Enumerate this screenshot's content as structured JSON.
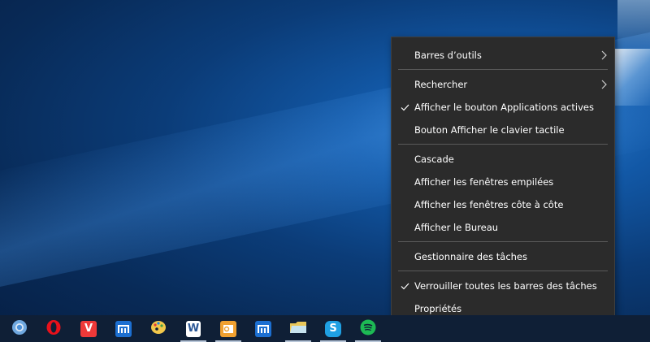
{
  "context_menu": {
    "items": [
      {
        "label": "Barres d’outils",
        "checked": false,
        "submenu": true
      },
      {
        "label": "Rechercher",
        "checked": false,
        "submenu": true
      },
      {
        "label": "Afficher le bouton Applications actives",
        "checked": true,
        "submenu": false
      },
      {
        "label": "Bouton Afficher le clavier tactile",
        "checked": false,
        "submenu": false
      },
      {
        "label": "Cascade",
        "checked": false,
        "submenu": false
      },
      {
        "label": "Afficher les fenêtres empilées",
        "checked": false,
        "submenu": false
      },
      {
        "label": "Afficher les fenêtres côte à côte",
        "checked": false,
        "submenu": false
      },
      {
        "label": "Afficher le Bureau",
        "checked": false,
        "submenu": false
      },
      {
        "label": "Gestionnaire des tâches",
        "checked": false,
        "submenu": false
      },
      {
        "label": "Verrouiller toutes les barres des tâches",
        "checked": true,
        "submenu": false
      },
      {
        "label": "Propriétés",
        "checked": false,
        "submenu": false
      }
    ]
  },
  "taskbar": {
    "apps": [
      {
        "icon": "chrome-icon",
        "color": "#4a8fd8",
        "active": false
      },
      {
        "icon": "opera-icon",
        "color": "#e8111b",
        "active": false
      },
      {
        "icon": "vivaldi-icon",
        "color": "#ef3939",
        "active": false
      },
      {
        "icon": "maxthon-icon",
        "color": "#1c6fd1",
        "active": false
      },
      {
        "icon": "paint-icon",
        "color": "#f2c84b",
        "active": false
      },
      {
        "icon": "word-icon",
        "color": "#2b5797",
        "active": true
      },
      {
        "icon": "outlook-icon",
        "color": "#f0a030",
        "active": true
      },
      {
        "icon": "maxthon-icon",
        "color": "#1c6fd1",
        "active": false
      },
      {
        "icon": "folder-icon",
        "color": "#e9c75a",
        "active": true
      },
      {
        "icon": "skype-icon",
        "color": "#1fa0e3",
        "active": true
      },
      {
        "icon": "spotify-icon",
        "color": "#1db954",
        "active": true
      }
    ]
  }
}
